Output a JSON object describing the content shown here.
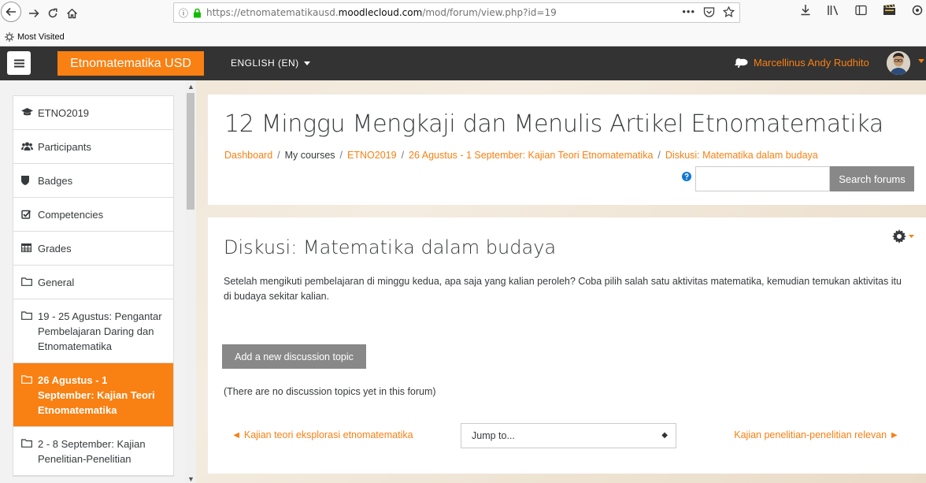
{
  "browser": {
    "url_prefix": "https://etnomatematikausd.",
    "url_domain": "moodlecloud.com",
    "url_path": "/mod/forum/view.php?id=19",
    "bookmarks_label": "Most Visited"
  },
  "navbar": {
    "brand": "Etnomatematika USD",
    "language": "ENGLISH (EN)",
    "username": "Marcellinus Andy Rudhito",
    "accent_color": "#f98012"
  },
  "drawer": {
    "items": [
      {
        "icon": "graduation-cap-icon",
        "label": "ETNO2019"
      },
      {
        "icon": "users-icon",
        "label": "Participants"
      },
      {
        "icon": "shield-icon",
        "label": "Badges"
      },
      {
        "icon": "check-square-icon",
        "label": "Competencies"
      },
      {
        "icon": "table-icon",
        "label": "Grades"
      },
      {
        "icon": "folder-icon",
        "label": "General"
      },
      {
        "icon": "folder-icon",
        "label": "19 - 25 Agustus: Pengantar Pembelajaran Daring dan Etnomatematika"
      },
      {
        "icon": "folder-icon",
        "label": "26 Agustus - 1 September: Kajian Teori Etnomatematika",
        "active": true
      },
      {
        "icon": "folder-icon",
        "label": "2 - 8 September: Kajian Penelitian-Penelitian"
      }
    ]
  },
  "header": {
    "title": "12 Minggu Mengkaji dan Menulis Artikel Etnomatematika",
    "breadcrumb": [
      "Dashboard",
      "My courses",
      "ETNO2019",
      "26 Agustus - 1 September: Kajian Teori Etnomatematika",
      "Diskusi: Matematika dalam budaya"
    ],
    "search_placeholder": "",
    "search_button": "Search forums"
  },
  "forum": {
    "title": "Diskusi: Matematika dalam budaya",
    "intro": "Setelah mengikuti pembelajaran di minggu kedua, apa saja yang kalian peroleh? Coba pilih salah satu aktivitas matematika, kemudian temukan aktivitas itu di budaya sekitar kalian.",
    "add_button": "Add a new discussion topic",
    "empty_message": "(There are no discussion topics yet in this forum)",
    "prev_link": "Kajian teori eksplorasi etnomatematika",
    "jump_to": "Jump to...",
    "next_link": "Kajian penelitian-penelitian relevan"
  }
}
